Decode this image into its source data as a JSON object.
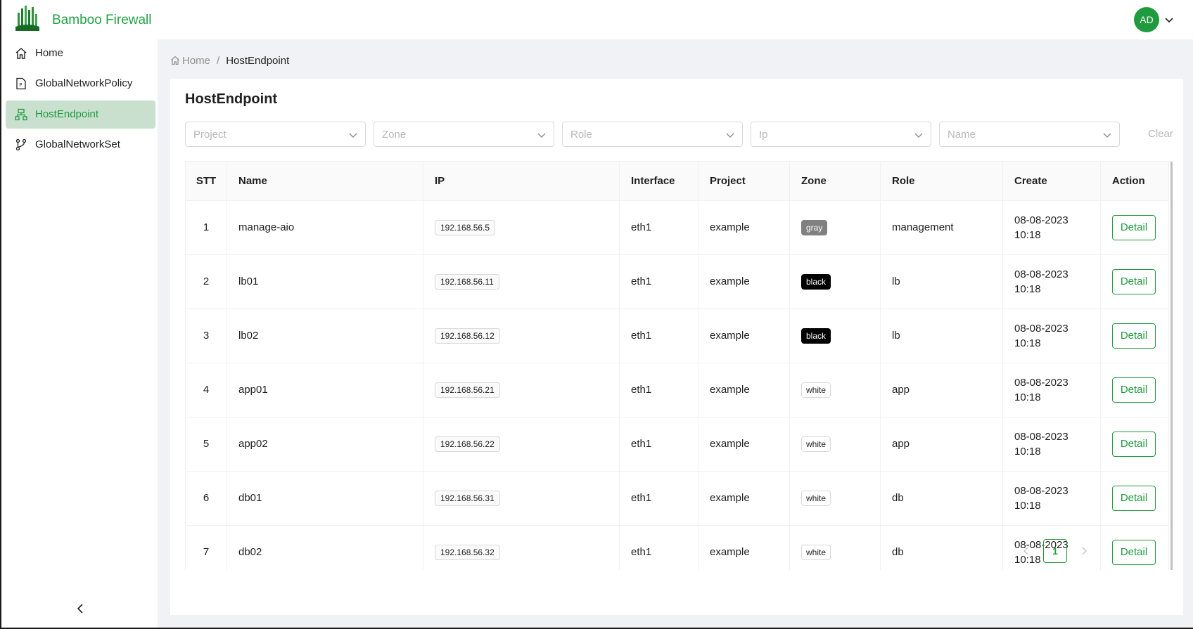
{
  "app": {
    "title": "Bamboo Firewall",
    "logo_icon": "bamboo-logo",
    "accent": "#1f9a3e"
  },
  "user": {
    "initials": "AD"
  },
  "sidebar": {
    "items": [
      {
        "label": "Home",
        "icon": "home-icon"
      },
      {
        "label": "GlobalNetworkPolicy",
        "icon": "policy-doc-icon"
      },
      {
        "label": "HostEndpoint",
        "icon": "network-tree-icon",
        "active": true
      },
      {
        "label": "GlobalNetworkSet",
        "icon": "branch-icon"
      }
    ]
  },
  "breadcrumb": {
    "home": "Home",
    "separator": "/",
    "current": "HostEndpoint"
  },
  "page": {
    "title": "HostEndpoint"
  },
  "filters": {
    "project": "Project",
    "zone": "Zone",
    "role": "Role",
    "ip": "Ip",
    "name": "Name",
    "clear": "Clear"
  },
  "table": {
    "columns": [
      "STT",
      "Name",
      "IP",
      "Interface",
      "Project",
      "Zone",
      "Role",
      "Create",
      "Action"
    ],
    "rows": [
      {
        "stt": "1",
        "name": "manage-aio",
        "ip": "192.168.56.5",
        "iface": "eth1",
        "project": "example",
        "zone": "gray",
        "role": "management",
        "date": "08-08-2023",
        "time": "10:18",
        "action": "Detail"
      },
      {
        "stt": "2",
        "name": "lb01",
        "ip": "192.168.56.11",
        "iface": "eth1",
        "project": "example",
        "zone": "black",
        "role": "lb",
        "date": "08-08-2023",
        "time": "10:18",
        "action": "Detail"
      },
      {
        "stt": "3",
        "name": "lb02",
        "ip": "192.168.56.12",
        "iface": "eth1",
        "project": "example",
        "zone": "black",
        "role": "lb",
        "date": "08-08-2023",
        "time": "10:18",
        "action": "Detail"
      },
      {
        "stt": "4",
        "name": "app01",
        "ip": "192.168.56.21",
        "iface": "eth1",
        "project": "example",
        "zone": "white",
        "role": "app",
        "date": "08-08-2023",
        "time": "10:18",
        "action": "Detail"
      },
      {
        "stt": "5",
        "name": "app02",
        "ip": "192.168.56.22",
        "iface": "eth1",
        "project": "example",
        "zone": "white",
        "role": "app",
        "date": "08-08-2023",
        "time": "10:18",
        "action": "Detail"
      },
      {
        "stt": "6",
        "name": "db01",
        "ip": "192.168.56.31",
        "iface": "eth1",
        "project": "example",
        "zone": "white",
        "role": "db",
        "date": "08-08-2023",
        "time": "10:18",
        "action": "Detail"
      },
      {
        "stt": "7",
        "name": "db02",
        "ip": "192.168.56.32",
        "iface": "eth1",
        "project": "example",
        "zone": "white",
        "role": "db",
        "date": "08-08-2023",
        "time": "10:18",
        "action": "Detail"
      }
    ]
  },
  "zone_colors": {
    "gray": {
      "bg": "#808080",
      "fg": "#ffffff",
      "border": "#808080"
    },
    "black": {
      "bg": "#000000",
      "fg": "#ffffff",
      "border": "#000000"
    },
    "white": {
      "bg": "#ffffff",
      "fg": "#1f1f1f",
      "border": "#d9d9d9"
    }
  },
  "pagination": {
    "current": "1"
  }
}
